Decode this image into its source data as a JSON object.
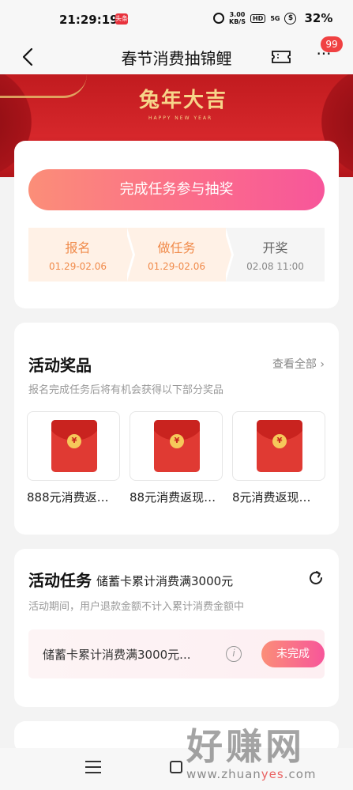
{
  "status": {
    "time": "21:29:19",
    "app_badge": "头条",
    "net_speed_top": "3.00",
    "net_speed_unit": "KB/S",
    "hd": "HD",
    "signal": "5G",
    "battery": "32%"
  },
  "nav": {
    "title": "春节消费抽锦鲤",
    "more_glyph": "···",
    "badge_count": "99"
  },
  "banner": {
    "calligraphy": "兔年大吉",
    "subtitle": "HAPPY NEW YEAR"
  },
  "signup": {
    "cta_label": "完成任务参与抽奖",
    "steps": [
      {
        "title": "报名",
        "date": "01.29-02.06"
      },
      {
        "title": "做任务",
        "date": "01.29-02.06"
      },
      {
        "title": "开奖",
        "date": "02.08 11:00"
      }
    ]
  },
  "prizes": {
    "title": "活动奖品",
    "view_all": "查看全部 ›",
    "subtitle": "报名完成任务后将有机会获得以下部分奖品",
    "items": [
      {
        "label": "888元消费返…",
        "icon": "red-envelope-icon"
      },
      {
        "label": "88元消费返现…",
        "icon": "red-envelope-icon"
      },
      {
        "label": "8元消费返现…",
        "icon": "red-envelope-icon"
      }
    ]
  },
  "tasks": {
    "title": "活动任务",
    "title_sub": "储蓄卡累计消费满3000元",
    "note": "活动期间，用户退款金额不计入累计消费金额中",
    "row_name": "储蓄卡累计消费满3000元...",
    "row_button": "未完成"
  },
  "watermark": {
    "big": "好赚网",
    "url_prefix": "www.zhuan",
    "url_highlight": "yes",
    "url_suffix": ".com"
  },
  "colors": {
    "accent_start": "#fb8e78",
    "accent_end": "#f7569a",
    "step_active": "#f08a4a",
    "banner_red": "#c11b1f"
  }
}
